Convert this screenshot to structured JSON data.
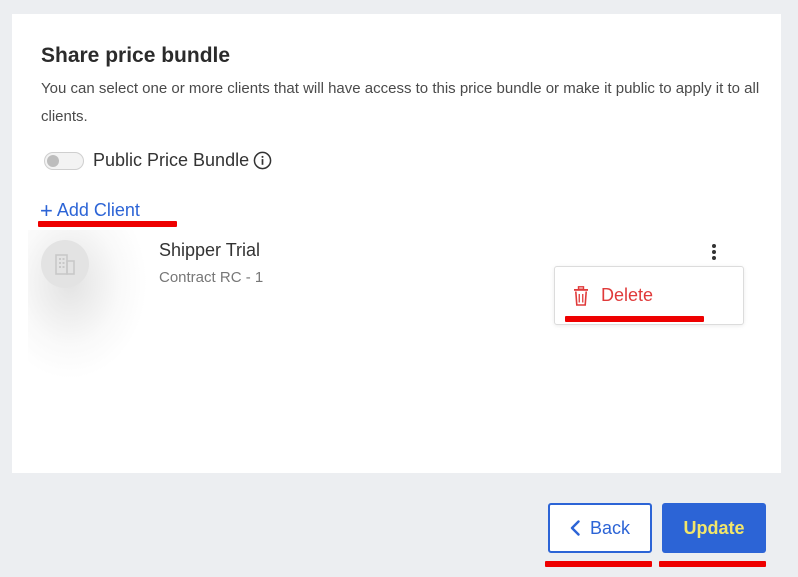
{
  "dialog": {
    "title": "Share price bundle",
    "description": "You can select one or more clients that will have access to this price bundle or make it public to apply it to all clients."
  },
  "public_toggle": {
    "label": "Public Price Bundle",
    "checked": false,
    "info_icon": "info-circle-icon"
  },
  "add_client": {
    "icon": "plus-icon",
    "label": "Add Client"
  },
  "clients": [
    {
      "name": "Shipper Trial",
      "contract": "Contract RC - 1",
      "avatar_icon": "building-icon",
      "menu_icon": "kebab-menu-icon"
    }
  ],
  "context_menu": {
    "items": [
      {
        "icon": "trash-icon",
        "label": "Delete"
      }
    ]
  },
  "footer": {
    "back_label": "Back",
    "back_icon": "chevron-left-icon",
    "update_label": "Update"
  },
  "colors": {
    "accent": "#2c64d6",
    "danger": "#e03a3a",
    "annotation": "#ee0000",
    "update_text": "#f2e66a"
  }
}
